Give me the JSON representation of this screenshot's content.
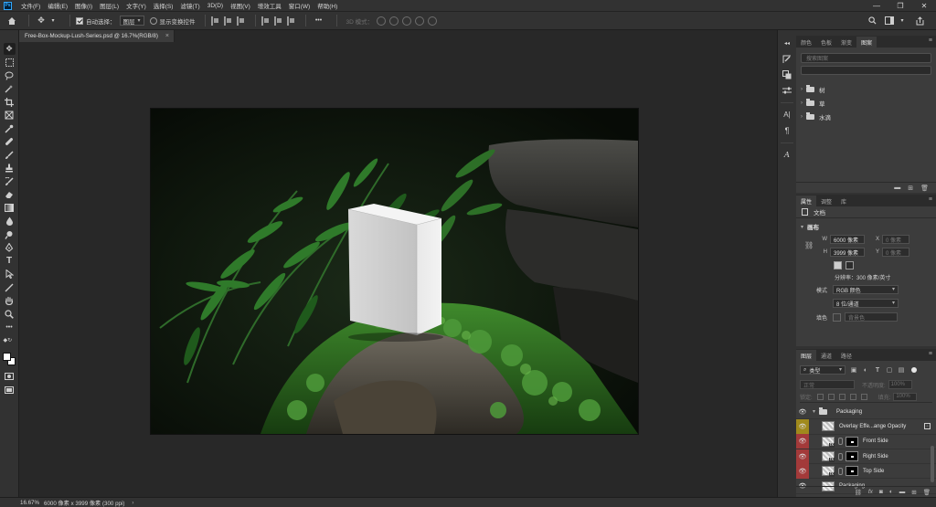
{
  "app": {
    "logo_text": "Ps"
  },
  "menu": {
    "items": [
      "文件(F)",
      "编辑(E)",
      "图像(I)",
      "图层(L)",
      "文字(Y)",
      "选择(S)",
      "滤镜(T)",
      "3D(D)",
      "视图(V)",
      "增效工具",
      "窗口(W)",
      "帮助(H)"
    ],
    "window_controls": [
      "—",
      "❐",
      "✕"
    ]
  },
  "options_bar": {
    "auto_select_label": "自动选择：",
    "auto_select_checked": true,
    "auto_select_target": "图层",
    "show_transform_label": "显示变换控件",
    "show_transform_checked": false,
    "more_label": "•••",
    "mode_3d_label": "3D 模式："
  },
  "document": {
    "tab_title": "Free-Box-Mockup-Lush-Series.psd @ 16.7%(RGB/8)",
    "close_glyph": "×"
  },
  "status_bar": {
    "zoom": "16.67%",
    "info": "6000 像素 x 3999 像素 (300 ppi)",
    "arrow": "›"
  },
  "libraries_panel": {
    "tabs": [
      "颜色",
      "色板",
      "渐变",
      "图案"
    ],
    "active_tab": 3,
    "search_placeholder": "搜索图案",
    "groups": [
      "树",
      "草",
      "水滴"
    ]
  },
  "properties_panel": {
    "tabs": [
      "属性",
      "调整",
      "库"
    ],
    "active_tab": 0,
    "doc_label": "文档",
    "canvas_section": "画布",
    "width_label": "W",
    "width_value": "6000 像素",
    "height_label": "H",
    "height_value": "3999 像素",
    "x_label": "X",
    "x_placeholder": "0 像素",
    "y_label": "Y",
    "y_placeholder": "0 像素",
    "resolution": "分辨率：300 像素/英寸",
    "mode_label": "模式",
    "mode_value": "RGB 颜色",
    "depth_value": "8 位/通道",
    "fill_label": "填色",
    "fill_value": "背景色"
  },
  "layers_panel": {
    "tabs": [
      "图层",
      "通道",
      "路径"
    ],
    "active_tab": 0,
    "filter_kind": "类型",
    "blend_mode": "正常",
    "opacity_label": "不透明度:",
    "opacity_value": "100%",
    "lock_label": "锁定:",
    "fill_label": "填充:",
    "fill_value": "100%",
    "layers": [
      {
        "name": "Packaging",
        "kind": "group",
        "eye": ""
      },
      {
        "name": "Overlay Effe...ange Opacity",
        "kind": "smart",
        "eye": "yellow"
      },
      {
        "name": "Front Side",
        "kind": "masked",
        "eye": "red"
      },
      {
        "name": "Right Side",
        "kind": "masked",
        "eye": "red"
      },
      {
        "name": "Top Side",
        "kind": "masked",
        "eye": "red"
      },
      {
        "name": "Packaging",
        "kind": "plain",
        "eye": ""
      }
    ],
    "footer_icons": [
      "link-icon",
      "fx-icon",
      "mask-icon",
      "adjustment-icon",
      "folder-icon",
      "new-layer-icon",
      "trash-icon"
    ]
  },
  "colors": {
    "accent_blue": "#31a8ff",
    "eye_yellow": "#a08a1c",
    "eye_red": "#a33a3a",
    "panel_bg": "#3c3c3c",
    "workspace_bg": "#282828"
  }
}
